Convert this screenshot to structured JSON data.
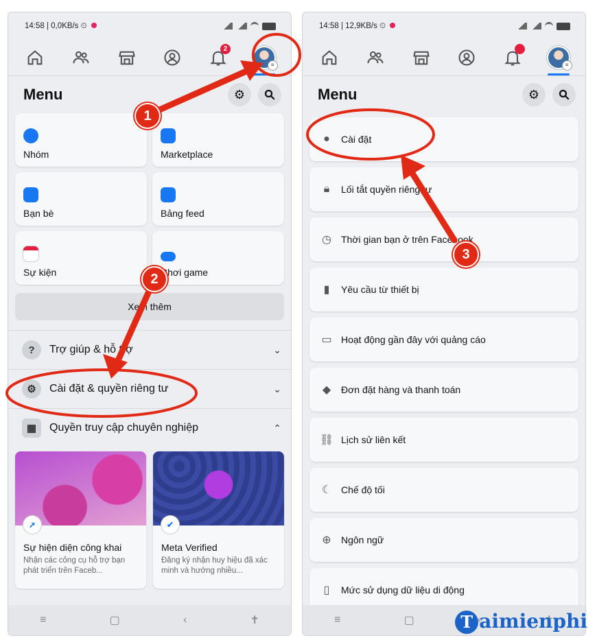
{
  "left": {
    "status": {
      "time": "14:58 | 0,0KB/s"
    },
    "notif_badge": "2",
    "menu_title": "Menu",
    "shortcut_cards": [
      {
        "label": "Nhóm",
        "color": "#1877f2"
      },
      {
        "label": "Marketplace",
        "color": "#1877f2"
      },
      {
        "label": "Bạn bè",
        "color": "#1877f2"
      },
      {
        "label": "Bảng feed",
        "color": "#1877f2"
      },
      {
        "label": "Sự kiện",
        "color": "#e41e3f"
      },
      {
        "label": "Chơi game",
        "color": "#1877f2"
      }
    ],
    "see_more": "Xem thêm",
    "sections": {
      "help": "Trợ giúp & hỗ trợ",
      "settings": "Cài đặt & quyền riêng tư",
      "professional": "Quyền truy cập chuyên nghiệp"
    },
    "pro_cards": [
      {
        "title": "Sự hiện diện công khai",
        "desc": "Nhận các công cụ hỗ trợ bạn phát triển trên Faceb..."
      },
      {
        "title": "Meta Verified",
        "desc": "Đăng ký nhận huy hiệu đã xác minh và hướng nhiều..."
      }
    ]
  },
  "right": {
    "status": {
      "time": "14:58 | 12,9KB/s"
    },
    "menu_title": "Menu",
    "settings_items": [
      {
        "label": "Cài đặt",
        "icon": "user-icon"
      },
      {
        "label": "Lối tắt quyền riêng tư",
        "icon": "lock-icon"
      },
      {
        "label": "Thời gian bạn ở trên Facebook",
        "icon": "clock-icon"
      },
      {
        "label": "Yêu cầu từ thiết bị",
        "icon": "device-icon"
      },
      {
        "label": "Hoạt động gần đây với quảng cáo",
        "icon": "ad-icon"
      },
      {
        "label": "Đơn đặt hàng và thanh toán",
        "icon": "tag-icon"
      },
      {
        "label": "Lịch sử liên kết",
        "icon": "link-icon"
      },
      {
        "label": "Chế độ tối",
        "icon": "moon-icon"
      },
      {
        "label": "Ngôn ngữ",
        "icon": "globe-icon"
      },
      {
        "label": "Mức sử dụng dữ liệu di động",
        "icon": "phone-icon"
      }
    ]
  },
  "annotations": {
    "step1": "1",
    "step2": "2",
    "step3": "3",
    "accent": "#e12a16"
  },
  "watermark": {
    "t": "T",
    "rest": "aimienphi"
  }
}
